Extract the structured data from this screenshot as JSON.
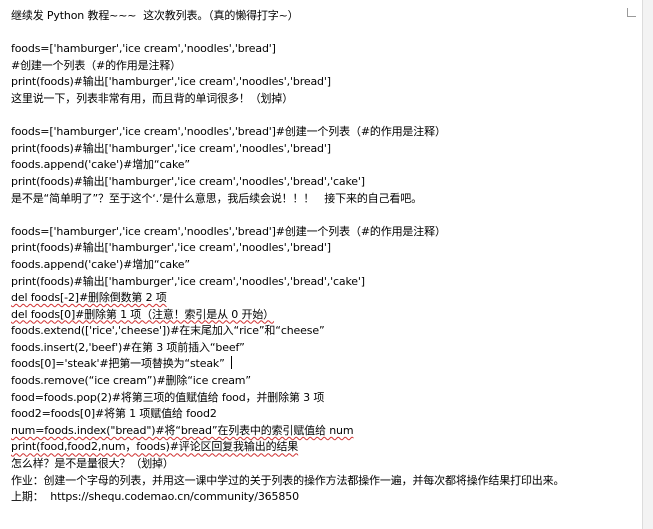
{
  "document": {
    "lines": [
      "继续发 Python 教程~~~  这次教列表。（真的懒得打字~）",
      "",
      "foods=['hamburger','ice cream','noodles','bread']",
      "#创建一个列表（#的作用是注释）",
      "print(foods)#输出['hamburger','ice cream','noodles','bread']",
      "这里说一下，列表非常有用，而且背的单词很多！（划掉）",
      "",
      "foods=['hamburger','ice cream','noodles','bread']#创建一个列表（#的作用是注释）",
      "print(foods)#输出['hamburger','ice cream','noodles','bread']",
      "foods.append('cake')#增加“cake”",
      "print(foods)#输出['hamburger','ice cream','noodles','bread','cake']",
      "是不是“简单明了”？至于这个‘.’是什么意思，我后续会说！！！   接下来的自己看吧。",
      "",
      "foods=['hamburger','ice cream','noodles','bread']#创建一个列表（#的作用是注释）",
      "print(foods)#输出['hamburger','ice cream','noodles','bread']",
      "foods.append('cake')#增加“cake”",
      "print(foods)#输出['hamburger','ice cream','noodles','bread','cake']",
      "del foods[-2]#删除倒数第 2 项",
      "del foods[0]#删除第 1 项（注意！索引是从 0 开始）",
      "foods.extend(['rice','cheese'])#在末尾加入“rice”和“cheese”",
      "foods.insert(2,'beef')#在第 3 项前插入“beef”",
      "foods[0]='steak'#把第一项替换为“steak”",
      "foods.remove(“ice cream”)#删除“ice cream”",
      "food=foods.pop(2)#将第三项的值赋值给 food，并删除第 3 项",
      "food2=foods[0]#将第 1 项赋值给 food2",
      "num=foods.index(\"bread\")#将“bread”在列表中的索引赋值给 num",
      "print(food,food2,num，foods)#评论区回复我输出的结果",
      "怎么样？是不是量很大？（划掉）",
      "作业：创建一个字母的列表，并用这一课中学过的关于列表的操作方法都操作一遍，并每次都将操作结果打印出来。",
      "上期：  https://shequ.codemao.cn/community/365850"
    ]
  }
}
